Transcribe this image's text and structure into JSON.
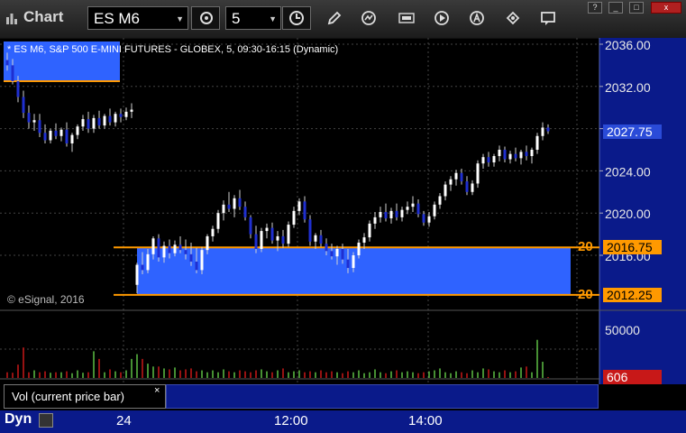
{
  "toolbar": {
    "title": "Chart",
    "symbol": "ES M6",
    "interval": "5",
    "icons": [
      "chart-logo-icon",
      "refresh-icon",
      "clock-icon",
      "pencil-icon",
      "draw-tools-icon",
      "get-data-icon",
      "play-icon",
      "alert-icon",
      "edit-icon",
      "comment-icon"
    ]
  },
  "window_controls": [
    "?",
    "_",
    "□",
    "x"
  ],
  "chart": {
    "title": "* ES M6, S&P 500 E-MINI FUTURES - GLOBEX, 5, 09:30-16:15 (Dynamic)",
    "copyright": "© eSignal, 2016",
    "price_ticks": [
      "2036.00",
      "2032.00",
      "2028.00",
      "2024.00",
      "2020.00",
      "2016.00"
    ],
    "current_price": "2027.75",
    "zones": [
      {
        "count": "20",
        "price": "2016.75"
      },
      {
        "count": "20",
        "price": "2012.25"
      }
    ],
    "volume_ticks": [
      "50000"
    ],
    "current_volume": "606",
    "volume_study": "Vol (current price bar)",
    "volume_close": "×",
    "time_labels": [
      "24",
      "12:00",
      "14:00"
    ],
    "colors": {
      "zone_fill": "#2f63ff",
      "zone_border": "#ff9900",
      "up_candle": "#ffffff",
      "down_candle": "#1f2fd0",
      "vol_up": "#5dbf44",
      "vol_down": "#c81818",
      "axis_bg": "#0a1a8a",
      "volume_badge": "#c81818"
    }
  },
  "bottom_bar": {
    "label": "Dyn"
  },
  "chart_data": {
    "type": "candlestick",
    "ylim": [
      2008,
      2037
    ],
    "candles": [
      [
        2034.5,
        2035.2,
        2033.5,
        2034
      ],
      [
        2034,
        2034.6,
        2032.2,
        2032.5
      ],
      [
        2032.5,
        2033,
        2030.5,
        2031
      ],
      [
        2031,
        2031.6,
        2029,
        2029.5
      ],
      [
        2029.5,
        2030.2,
        2028,
        2028.6
      ],
      [
        2028.6,
        2029.4,
        2027.8,
        2028.8
      ],
      [
        2028.8,
        2029.4,
        2027.2,
        2027.6
      ],
      [
        2027.6,
        2028.4,
        2026.6,
        2026.9
      ],
      [
        2026.9,
        2028,
        2026.6,
        2027.8
      ],
      [
        2027.8,
        2028.5,
        2027,
        2027.3
      ],
      [
        2027.3,
        2028.1,
        2026.8,
        2027.9
      ],
      [
        2027.9,
        2028.6,
        2026.3,
        2026.6
      ],
      [
        2026.6,
        2027.6,
        2025.8,
        2027.4
      ],
      [
        2027.4,
        2028.4,
        2027,
        2028.2
      ],
      [
        2028.2,
        2029.3,
        2027.8,
        2028.9
      ],
      [
        2028.9,
        2029.6,
        2027.6,
        2028
      ],
      [
        2028,
        2029.3,
        2027.6,
        2029
      ],
      [
        2029,
        2029.7,
        2028,
        2028.3
      ],
      [
        2028.3,
        2029.4,
        2028,
        2029.2
      ],
      [
        2029.2,
        2029.9,
        2028.3,
        2028.6
      ],
      [
        2028.6,
        2029.6,
        2028.2,
        2029.4
      ],
      [
        2029.4,
        2029.9,
        2028.6,
        2029.1
      ],
      [
        2029.1,
        2030,
        2028.8,
        2029.6
      ],
      [
        2029.6,
        2030.4,
        2029,
        2029.8
      ],
      [
        2013.2,
        2015.3,
        2012.4,
        2015.1
      ],
      [
        2015.1,
        2016.3,
        2014.2,
        2014.6
      ],
      [
        2014.6,
        2016.6,
        2014.3,
        2016.1
      ],
      [
        2016.1,
        2017.8,
        2015.6,
        2017.6
      ],
      [
        2017.6,
        2018,
        2015.4,
        2015.8
      ],
      [
        2015.8,
        2017.3,
        2015.3,
        2016.9
      ],
      [
        2016.9,
        2017.5,
        2015.7,
        2016.2
      ],
      [
        2016.2,
        2017.4,
        2015.9,
        2017
      ],
      [
        2017,
        2017.8,
        2016.2,
        2016.5
      ],
      [
        2016.5,
        2017.5,
        2015.6,
        2016.1
      ],
      [
        2016.1,
        2017.2,
        2015,
        2015.4
      ],
      [
        2015.4,
        2016.7,
        2014.3,
        2014.6
      ],
      [
        2014.6,
        2016.8,
        2014.2,
        2016.5
      ],
      [
        2016.5,
        2018,
        2016.1,
        2017.8
      ],
      [
        2017.8,
        2018.8,
        2017.3,
        2018.5
      ],
      [
        2018.5,
        2020.3,
        2018.1,
        2020
      ],
      [
        2020,
        2021.2,
        2019.3,
        2020.8
      ],
      [
        2020.8,
        2022,
        2020.1,
        2020.4
      ],
      [
        2020.4,
        2021.7,
        2019.6,
        2021.4
      ],
      [
        2021.4,
        2022.2,
        2020.3,
        2020.6
      ],
      [
        2020.6,
        2021.1,
        2019.3,
        2019.6
      ],
      [
        2019.6,
        2019.8,
        2017.6,
        2018
      ],
      [
        2018,
        2018.8,
        2016.2,
        2016.6
      ],
      [
        2016.6,
        2018.6,
        2016.3,
        2018.3
      ],
      [
        2018.3,
        2019,
        2017.6,
        2018.6
      ],
      [
        2018.6,
        2019.1,
        2017.1,
        2017.4
      ],
      [
        2017.4,
        2018.3,
        2016.4,
        2017.8
      ],
      [
        2017.8,
        2018.4,
        2016.7,
        2017.1
      ],
      [
        2017.1,
        2019.2,
        2016.8,
        2018.9
      ],
      [
        2018.9,
        2020.6,
        2018.6,
        2020.2
      ],
      [
        2020.2,
        2021.4,
        2019.8,
        2021.1
      ],
      [
        2021.1,
        2021.6,
        2019.1,
        2019.4
      ],
      [
        2019.4,
        2019.8,
        2016.9,
        2017.3
      ],
      [
        2017.3,
        2018.1,
        2016.6,
        2017.9
      ],
      [
        2017.9,
        2018.4,
        2016.8,
        2017.1
      ],
      [
        2017.1,
        2017.6,
        2016,
        2016.4
      ],
      [
        2016.4,
        2017.1,
        2015.6,
        2015.9
      ],
      [
        2015.9,
        2016.9,
        2015.1,
        2016.6
      ],
      [
        2016.6,
        2017.1,
        2015.2,
        2015.6
      ],
      [
        2015.6,
        2016.6,
        2014.3,
        2014.8
      ],
      [
        2014.8,
        2016.3,
        2014.4,
        2016
      ],
      [
        2016,
        2017.5,
        2015.7,
        2017.2
      ],
      [
        2017.2,
        2018.1,
        2016.6,
        2017.7
      ],
      [
        2017.7,
        2019.3,
        2017.3,
        2019
      ],
      [
        2019,
        2020.1,
        2018.5,
        2019.6
      ],
      [
        2019.6,
        2020.6,
        2019.1,
        2020.1
      ],
      [
        2020.1,
        2020.9,
        2019.2,
        2019.5
      ],
      [
        2019.5,
        2020.5,
        2019,
        2020.2
      ],
      [
        2020.2,
        2020.9,
        2019.3,
        2019.6
      ],
      [
        2019.6,
        2020.6,
        2019.2,
        2020.3
      ],
      [
        2020.3,
        2021.1,
        2019.9,
        2020.6
      ],
      [
        2020.6,
        2021.6,
        2020.1,
        2020.9
      ],
      [
        2020.9,
        2021.3,
        2019.6,
        2019.9
      ],
      [
        2019.9,
        2020.2,
        2018.8,
        2019.1
      ],
      [
        2019.1,
        2020.1,
        2018.7,
        2019.7
      ],
      [
        2019.7,
        2021.1,
        2019.4,
        2020.8
      ],
      [
        2020.8,
        2021.9,
        2020.4,
        2021.6
      ],
      [
        2021.6,
        2023,
        2021.2,
        2022.7
      ],
      [
        2022.7,
        2023.5,
        2022.1,
        2023.2
      ],
      [
        2023.2,
        2024.1,
        2022.6,
        2023.8
      ],
      [
        2023.8,
        2024.2,
        2022.7,
        2023
      ],
      [
        2023,
        2023.5,
        2021.7,
        2022
      ],
      [
        2022,
        2023.1,
        2021.7,
        2022.8
      ],
      [
        2022.8,
        2025,
        2022.4,
        2024.7
      ],
      [
        2024.7,
        2025.6,
        2024.2,
        2025.3
      ],
      [
        2025.3,
        2025.8,
        2024.4,
        2024.8
      ],
      [
        2024.8,
        2025.6,
        2024.4,
        2025.4
      ],
      [
        2025.4,
        2026.4,
        2024.9,
        2026
      ],
      [
        2026,
        2026.3,
        2024.8,
        2025.1
      ],
      [
        2025.1,
        2025.9,
        2024.7,
        2025.6
      ],
      [
        2025.6,
        2026.2,
        2024.9,
        2025.2
      ],
      [
        2025.2,
        2026,
        2024.6,
        2025.8
      ],
      [
        2025.8,
        2026.4,
        2025,
        2025.4
      ],
      [
        2025.4,
        2026.2,
        2024.7,
        2026
      ],
      [
        2026,
        2027.6,
        2025.6,
        2027.3
      ],
      [
        2027.3,
        2028.6,
        2026.9,
        2028.1
      ],
      [
        2028.1,
        2028.4,
        2027.5,
        2027.75
      ]
    ],
    "volume": [
      60,
      55,
      140,
      320,
      60,
      80,
      60,
      70,
      55,
      60,
      60,
      70,
      50,
      80,
      55,
      60,
      280,
      200,
      60,
      90,
      70,
      60,
      80,
      200,
      250,
      200,
      150,
      120,
      120,
      100,
      90,
      110,
      80,
      90,
      100,
      70,
      80,
      60,
      80,
      60,
      90,
      70,
      60,
      80,
      70,
      60,
      80,
      90,
      70,
      60,
      80,
      100,
      60,
      70,
      80,
      60,
      70,
      60,
      80,
      60,
      70,
      60,
      50,
      70,
      60,
      80,
      50,
      60,
      90,
      60,
      50,
      70,
      80,
      60,
      70,
      60,
      50,
      60,
      70,
      80,
      100,
      60,
      50,
      70,
      60,
      50,
      80,
      60,
      100,
      90,
      70,
      60,
      80,
      60,
      70,
      110,
      120,
      60,
      400,
      170,
      10
    ],
    "volume_ylim": [
      0,
      70000
    ]
  }
}
